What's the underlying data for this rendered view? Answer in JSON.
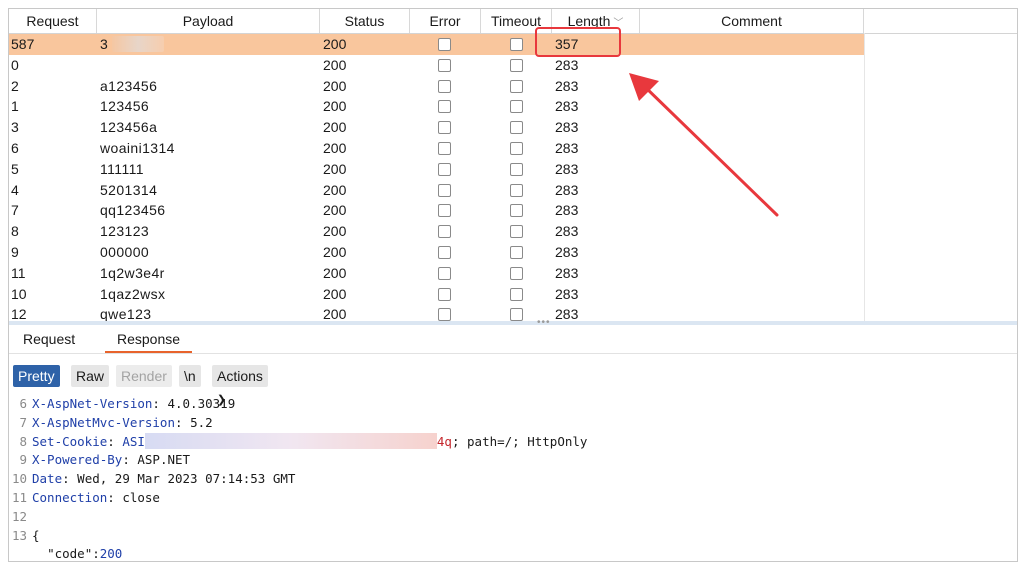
{
  "table": {
    "columns": [
      "Request",
      "Payload",
      "Status",
      "Error",
      "Timeout",
      "Length",
      "Comment"
    ],
    "rows": [
      {
        "request": "587",
        "payload": "3",
        "status": "200",
        "length": "357",
        "selected": true
      },
      {
        "request": "0",
        "payload": "",
        "status": "200",
        "length": "283"
      },
      {
        "request": "2",
        "payload": "a123456",
        "status": "200",
        "length": "283"
      },
      {
        "request": "1",
        "payload": "123456",
        "status": "200",
        "length": "283"
      },
      {
        "request": "3",
        "payload": "123456a",
        "status": "200",
        "length": "283"
      },
      {
        "request": "6",
        "payload": "woaini1314",
        "status": "200",
        "length": "283"
      },
      {
        "request": "5",
        "payload": "111111",
        "status": "200",
        "length": "283"
      },
      {
        "request": "4",
        "payload": "5201314",
        "status": "200",
        "length": "283"
      },
      {
        "request": "7",
        "payload": "qq123456",
        "status": "200",
        "length": "283"
      },
      {
        "request": "8",
        "payload": "123123",
        "status": "200",
        "length": "283"
      },
      {
        "request": "9",
        "payload": "000000",
        "status": "200",
        "length": "283"
      },
      {
        "request": "11",
        "payload": "1q2w3e4r",
        "status": "200",
        "length": "283"
      },
      {
        "request": "10",
        "payload": "1qaz2wsx",
        "status": "200",
        "length": "283"
      },
      {
        "request": "12",
        "payload": "qwe123",
        "status": "200",
        "length": "283"
      }
    ]
  },
  "tabs": {
    "request": "Request",
    "response": "Response"
  },
  "toolbar": {
    "pretty": "Pretty",
    "raw": "Raw",
    "render": "Render",
    "newline": "\\n",
    "actions": "Actions"
  },
  "response": {
    "lines": [
      {
        "n": "6",
        "key": "X-AspNet-Version",
        "value": "4.0.30319"
      },
      {
        "n": "7",
        "key": "X-AspNetMvc-Version",
        "value": "5.2"
      },
      {
        "n": "8",
        "key": "Set-Cookie",
        "value_prefix": "ASI",
        "value_redacted_end": "4q",
        "value_suffix": "; path=/; HttpOnly"
      },
      {
        "n": "9",
        "key": "X-Powered-By",
        "value": "ASP.NET"
      },
      {
        "n": "10",
        "key": "Date",
        "value": "Wed, 29 Mar 2023 07:14:53 GMT"
      },
      {
        "n": "11",
        "key": "Connection",
        "value": "close"
      },
      {
        "n": "12",
        "text": ""
      },
      {
        "n": "13",
        "text": "{"
      },
      {
        "n": "",
        "json_key": "\"code\"",
        "json_value": "200"
      }
    ]
  },
  "colors": {
    "selected_row": "#f9c69d",
    "highlight": "#e8383d",
    "active_tab": "#e8632b",
    "pretty_btn": "#2e62a8"
  }
}
